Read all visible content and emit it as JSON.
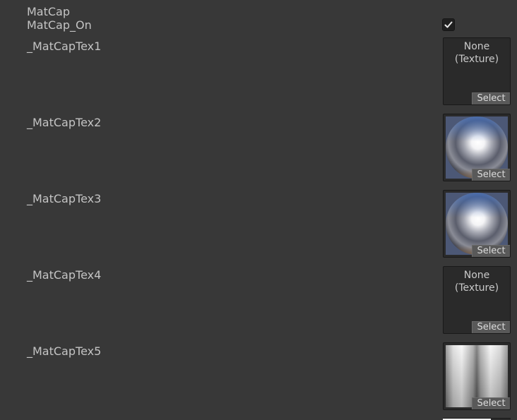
{
  "section": {
    "title": "MatCap"
  },
  "toggle": {
    "label": "MatCap_On",
    "checked": true,
    "icon": "checkmark-icon"
  },
  "textures": [
    {
      "label": "_MatCapTex1",
      "assigned": false,
      "none_text": "None\n(Texture)",
      "select_label": "Select"
    },
    {
      "label": "_MatCapTex2",
      "assigned": true,
      "preview": "chrome-sphere-matcap",
      "select_label": "Select"
    },
    {
      "label": "_MatCapTex3",
      "assigned": true,
      "preview": "chrome-sphere-matcap",
      "select_label": "Select"
    },
    {
      "label": "_MatCapTex4",
      "assigned": false,
      "none_text": "None\n(Texture)",
      "select_label": "Select"
    },
    {
      "label": "_MatCapTex5",
      "assigned": true,
      "preview": "gray-vertical-gradient",
      "select_label": "Select"
    }
  ],
  "colors": {
    "background": "#383838",
    "text": "#c4c4c4",
    "slot_bg": "#2a2a2a",
    "select_bg": "#595959"
  }
}
